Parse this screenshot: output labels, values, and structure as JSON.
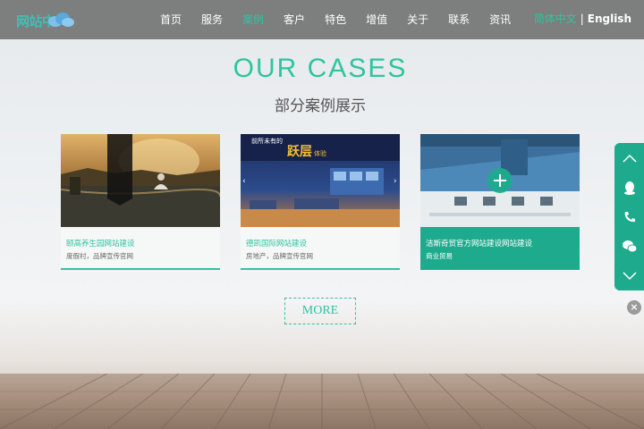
{
  "header": {
    "logo_text": "网站中",
    "nav": [
      "首页",
      "服务",
      "案例",
      "客户",
      "特色",
      "增值",
      "关于",
      "联系",
      "资讯"
    ],
    "active_index": 2,
    "lang_cn": "简体中文",
    "lang_sep": "|",
    "lang_en": "English"
  },
  "section": {
    "title_en": "OUR CASES",
    "title_cn": "部分案例展示"
  },
  "cases": [
    {
      "title": "颐高养生园网站建设",
      "sub": "度假村，品牌宣传官网"
    },
    {
      "title": "德凯国际网站建设",
      "sub": "房地产，品牌宣传官网"
    },
    {
      "title": "洁斯奇贸官方网站建设网站建设",
      "sub": "商业贸易"
    }
  ],
  "case2_banner": {
    "line1": "前所未有的",
    "line2": "跃层",
    "line3": "体验"
  },
  "more_label": "MORE",
  "side_widget": {
    "items": [
      "chevron-up-icon",
      "qq-icon",
      "phone-icon",
      "wechat-icon",
      "chevron-down-icon"
    ]
  },
  "close_label": "×",
  "colors": {
    "accent": "#2ec4a0",
    "accent_dark": "#1eab8d",
    "topbar": "#6e6e6e"
  }
}
